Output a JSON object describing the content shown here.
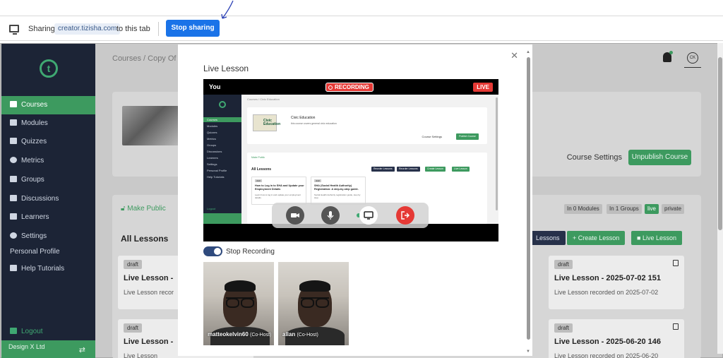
{
  "share_bar": {
    "label_prefix": "Sharing",
    "domain": "creator.tizisha.com",
    "label_suffix": "to this tab",
    "stop_button": "Stop sharing"
  },
  "sidebar": {
    "items": [
      {
        "label": "Courses",
        "icon": "book-icon",
        "active": true
      },
      {
        "label": "Modules",
        "icon": "grid-icon"
      },
      {
        "label": "Quizzes",
        "icon": "list-icon"
      },
      {
        "label": "Metrics",
        "icon": "pie-chart-icon"
      },
      {
        "label": "Groups",
        "icon": "group-icon"
      },
      {
        "label": "Discussions",
        "icon": "chat-icon"
      },
      {
        "label": "Learners",
        "icon": "users-icon"
      },
      {
        "label": "Settings",
        "icon": "gear-icon"
      }
    ],
    "personal_profile": "Personal Profile",
    "help": "Help Tutorials",
    "logout": "Logout",
    "org_name": "Design X Ltd"
  },
  "header": {
    "breadcrumb": "Courses / Copy Of Co",
    "avatar_initials": "CK"
  },
  "course": {
    "settings_link": "Course Settings",
    "unpublish_button": "Unpublish Course"
  },
  "lessons": {
    "make_public": "Make Public",
    "heading": "All Lessons",
    "badges": [
      "In 0 Modules",
      "In 1 Groups",
      "live",
      "private"
    ],
    "buttons": {
      "reorder": "Lessons",
      "create": "Create Lesson",
      "live": "Live Lesson"
    },
    "cards": [
      {
        "status": "draft",
        "title": "Live Lesson -",
        "desc": "Live Lesson recor"
      },
      {
        "status": "draft",
        "title": "Live Lesson - 2025-07-02 151",
        "desc": "Live Lesson recorded on 2025-07-02"
      },
      {
        "status": "draft",
        "title": "Live Lesson -",
        "desc": "Live Lesson"
      },
      {
        "status": "draft",
        "title": "Live Lesson - 2025-06-20 146",
        "desc": "Live Lesson recorded on 2025-06-20"
      }
    ]
  },
  "modal": {
    "title": "Live Lesson",
    "stage": {
      "you_label": "You",
      "recording_label": "RECORDING",
      "live_label": "LIVE",
      "shared_screen": {
        "breadcrumb": "Courses / Civic Education",
        "course_title": "Civic Education",
        "course_sub": "this course covers general civic education",
        "thumb_text": "Civic Education",
        "course_settings": "Course Settings",
        "publish_button": "Publish Course",
        "make_public": "Make Public",
        "all_lessons": "All Lessons",
        "badges": [
          "Reorder Lessons",
          "Reorder Lessons",
          "Create Lesson",
          "Live Lesson"
        ],
        "nav": [
          "Courses",
          "Modules",
          "Quizzes",
          "Metrics",
          "Groups",
          "Discussions",
          "Learners",
          "Settings",
          "Personal Profile",
          "Help Tutorials"
        ],
        "logout": "Logout",
        "lesson_cards": [
          {
            "status": "draft",
            "title": "How to Log in to SHA and Update your Employment Details",
            "desc": "Learn how to log in and update your employment details."
          },
          {
            "status": "draft",
            "title": "SHA (Social Health Authority) Registration: A step-by-step guide.",
            "desc": "Social Health Authority registration guide, step by step."
          }
        ]
      }
    },
    "stop_recording_label": "Stop Recording",
    "participants": [
      {
        "name": "matteokelvin60",
        "role": "(Co-Host)"
      },
      {
        "name": "allan",
        "role": "(Co-Host)"
      }
    ]
  }
}
